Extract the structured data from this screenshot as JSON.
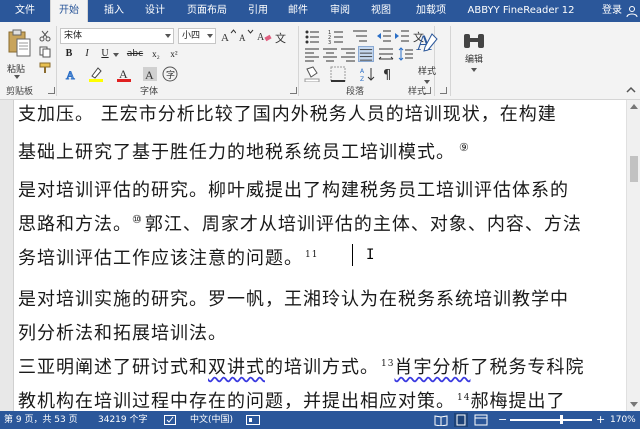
{
  "tabs": {
    "file": "文件",
    "items": [
      "开始",
      "插入",
      "设计",
      "页面布局",
      "引用",
      "邮件",
      "审阅",
      "视图",
      "加载项",
      "ABBYY FineReader 12"
    ],
    "active_index": 0,
    "login": "登录"
  },
  "ribbon": {
    "paste_label": "粘贴",
    "font_name": "宋体",
    "font_size": "小四",
    "bold": "B",
    "italic": "I",
    "underline": "U",
    "strike": "abc",
    "subscript": "x₂",
    "superscript": "x²",
    "groups": {
      "clipboard": "剪贴板",
      "font": "字体",
      "paragraph": "段落",
      "styles": "样式",
      "editing": "编辑"
    },
    "styles_label": "样式",
    "editing_label": "编辑",
    "accent_color": "#2b579a"
  },
  "document": {
    "lines": [
      {
        "id": "l0",
        "text": "支加压。 王宏市分析比较了国内外税务人员的培训现状，在构建"
      },
      {
        "id": "l1",
        "text": "基础上研究了基于胜任力的地税系统员工培训模式。",
        "mark": "⑨"
      },
      {
        "id": "l2",
        "text": "是对培训评估的研究。柳叶威提出了构建税务员工培训评估体系的"
      },
      {
        "id": "l3a",
        "text": "思路和方法。",
        "mark": "⑩",
        "rest": "郭江、周家才从培训评估的主体、对象、内容、方法"
      },
      {
        "id": "l4",
        "text": "务培训评估工作应该注意的问题。",
        "sup": "11"
      },
      {
        "id": "l5",
        "text": "是对培训实施的研究。罗一帆，王湘玲认为在税务系统培训教学中"
      },
      {
        "id": "l6",
        "text": "列分析法和拓展培训法。"
      },
      {
        "id": "l7a",
        "text": "三亚明阐述了研讨式和",
        "squig1": "双讲式",
        "mid": "的培训方式。",
        "sup": "13",
        "squig2": "肖宇分析",
        "rest": "了税务专科院"
      },
      {
        "id": "l8",
        "text": "教机构在培训过程中存在的问题，并提出相应对策。",
        "sup": "14",
        "rest": "郝梅提出了"
      }
    ]
  },
  "status": {
    "page": "第 9 页，共 53 页",
    "words": "34219 个字",
    "language": "中文(中国)",
    "zoom": "170%"
  }
}
